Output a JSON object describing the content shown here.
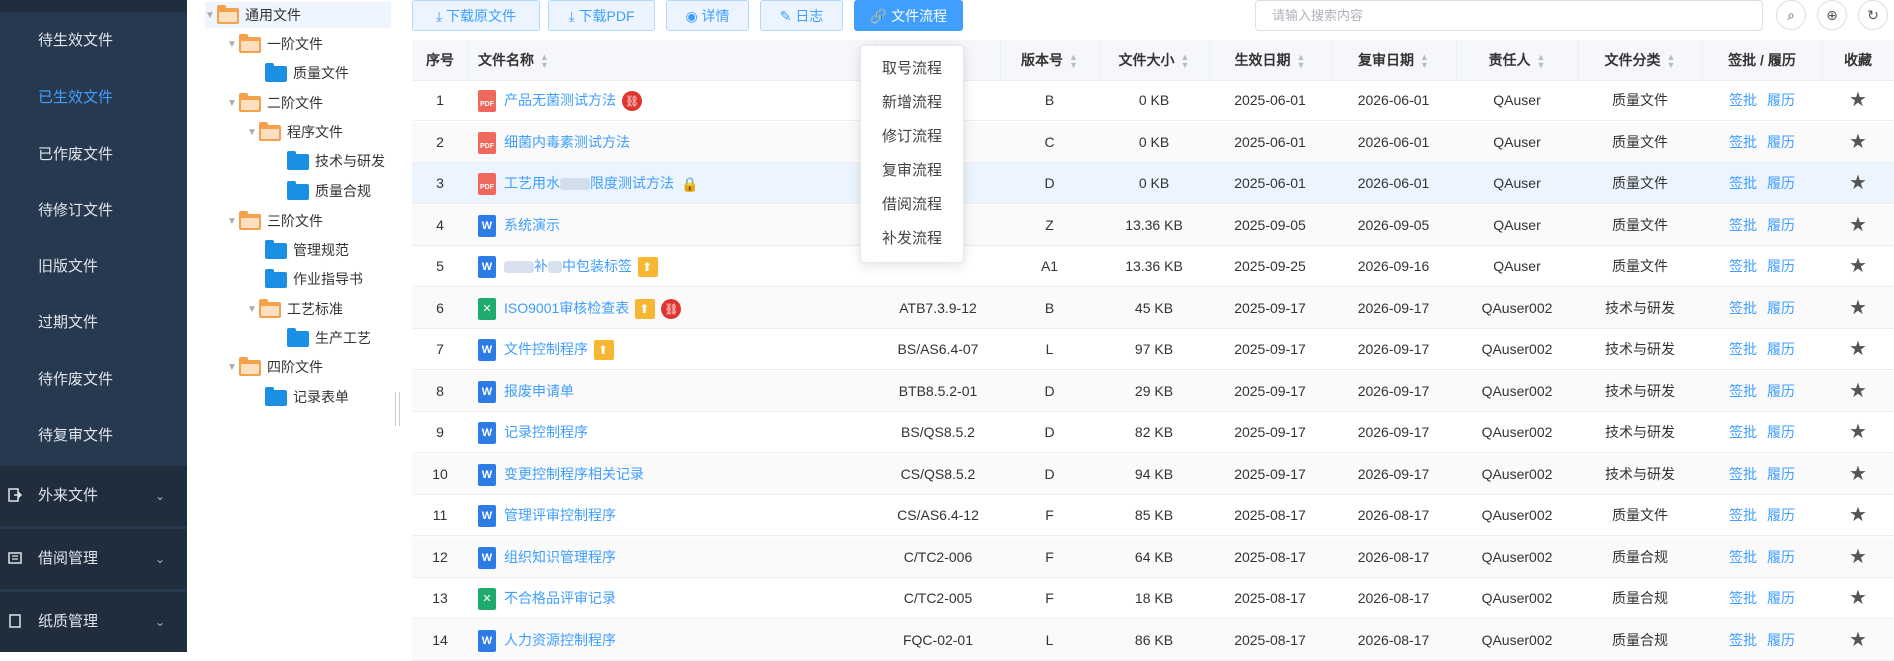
{
  "sidebar": {
    "items": [
      {
        "label": "待生效文件"
      },
      {
        "label": "已生效文件"
      },
      {
        "label": "已作废文件"
      },
      {
        "label": "待修订文件"
      },
      {
        "label": "旧版文件"
      },
      {
        "label": "过期文件"
      },
      {
        "label": "待作废文件"
      },
      {
        "label": "待复审文件"
      }
    ],
    "groups": [
      {
        "label": "外来文件"
      },
      {
        "label": "借阅管理"
      },
      {
        "label": "纸质管理"
      }
    ]
  },
  "tree": {
    "nodes": [
      {
        "label": "通用文件"
      },
      {
        "label": "一阶文件"
      },
      {
        "label": "质量文件"
      },
      {
        "label": "二阶文件"
      },
      {
        "label": "程序文件"
      },
      {
        "label": "技术与研发"
      },
      {
        "label": "质量合规"
      },
      {
        "label": "三阶文件"
      },
      {
        "label": "管理规范"
      },
      {
        "label": "作业指导书"
      },
      {
        "label": "工艺标准"
      },
      {
        "label": "生产工艺"
      },
      {
        "label": "四阶文件"
      },
      {
        "label": "记录表单"
      }
    ]
  },
  "toolbar": {
    "download_original": "下载原文件",
    "download_pdf": "下载PDF",
    "details": "详情",
    "log": "日志",
    "file_flow": "文件流程",
    "search_placeholder": "请输入搜索内容"
  },
  "dropdown": {
    "items": [
      "取号流程",
      "新增流程",
      "修订流程",
      "复审流程",
      "借阅流程",
      "补发流程"
    ]
  },
  "table": {
    "headers": {
      "index": "序号",
      "name": "文件名称",
      "version": "版本号",
      "size": "文件大小",
      "effective": "生效日期",
      "review": "复审日期",
      "owner": "责任人",
      "category": "文件分类",
      "actions": "签批 / 履历",
      "fav": "收藏"
    },
    "action_labels": {
      "sign": "签批",
      "history": "履历"
    },
    "rows": [
      {
        "idx": "1",
        "type": "pdf",
        "name": "产品无菌测试方法",
        "code": "",
        "ver": "B",
        "size": "0 KB",
        "eff": "2025-06-01",
        "rev": "2026-06-01",
        "owner": "QAuser",
        "cat": "质量文件"
      },
      {
        "idx": "2",
        "type": "pdf",
        "name": "细菌内毒素测试方法",
        "code": "",
        "ver": "C",
        "size": "0 KB",
        "eff": "2025-06-01",
        "rev": "2026-06-01",
        "owner": "QAuser",
        "cat": "质量文件"
      },
      {
        "idx": "3",
        "type": "pdf",
        "name": "工艺用水",
        "name_tail": "限度测试方法",
        "code": "",
        "ver": "D",
        "size": "0 KB",
        "eff": "2025-06-01",
        "rev": "2026-06-01",
        "owner": "QAuser",
        "cat": "质量文件"
      },
      {
        "idx": "4",
        "type": "w",
        "name": "系统演示",
        "code": "",
        "ver": "Z",
        "size": "13.36 KB",
        "eff": "2025-09-05",
        "rev": "2026-09-05",
        "owner": "QAuser",
        "cat": "质量文件"
      },
      {
        "idx": "5",
        "type": "w",
        "name": "补",
        "name_tail": "中包装标签",
        "code": "",
        "ver": "A1",
        "size": "13.36 KB",
        "eff": "2025-09-25",
        "rev": "2026-09-16",
        "owner": "QAuser",
        "cat": "质量文件"
      },
      {
        "idx": "6",
        "type": "x",
        "name": "ISO9001审核检查表",
        "code": "ATB7.3.9-12",
        "ver": "B",
        "size": "45 KB",
        "eff": "2025-09-17",
        "rev": "2026-09-17",
        "owner": "QAuser002",
        "cat": "技术与研发"
      },
      {
        "idx": "7",
        "type": "w",
        "name": "文件控制程序",
        "code": "BS/AS6.4-07",
        "ver": "L",
        "size": "97 KB",
        "eff": "2025-09-17",
        "rev": "2026-09-17",
        "owner": "QAuser002",
        "cat": "技术与研发"
      },
      {
        "idx": "8",
        "type": "w",
        "name": "报废申请单",
        "code": "BTB8.5.2-01",
        "ver": "D",
        "size": "29 KB",
        "eff": "2025-09-17",
        "rev": "2026-09-17",
        "owner": "QAuser002",
        "cat": "技术与研发"
      },
      {
        "idx": "9",
        "type": "w",
        "name": "记录控制程序",
        "code": "BS/QS8.5.2",
        "ver": "D",
        "size": "82 KB",
        "eff": "2025-09-17",
        "rev": "2026-09-17",
        "owner": "QAuser002",
        "cat": "技术与研发"
      },
      {
        "idx": "10",
        "type": "w",
        "name": "变更控制程序相关记录",
        "code": "CS/QS8.5.2",
        "ver": "D",
        "size": "94 KB",
        "eff": "2025-09-17",
        "rev": "2026-09-17",
        "owner": "QAuser002",
        "cat": "技术与研发"
      },
      {
        "idx": "11",
        "type": "w",
        "name": "管理评审控制程序",
        "code": "CS/AS6.4-12",
        "ver": "F",
        "size": "85 KB",
        "eff": "2025-08-17",
        "rev": "2026-08-17",
        "owner": "QAuser002",
        "cat": "质量文件"
      },
      {
        "idx": "12",
        "type": "w",
        "name": "组织知识管理程序",
        "code": "C/TC2-006",
        "ver": "F",
        "size": "64 KB",
        "eff": "2025-08-17",
        "rev": "2026-08-17",
        "owner": "QAuser002",
        "cat": "质量合规"
      },
      {
        "idx": "13",
        "type": "x",
        "name": "不合格品评审记录",
        "code": "C/TC2-005",
        "ver": "F",
        "size": "18 KB",
        "eff": "2025-08-17",
        "rev": "2026-08-17",
        "owner": "QAuser002",
        "cat": "质量合规"
      },
      {
        "idx": "14",
        "type": "w",
        "name": "人力资源控制程序",
        "code": "FQC-02-01",
        "ver": "L",
        "size": "86 KB",
        "eff": "2025-08-17",
        "rev": "2026-08-17",
        "owner": "QAuser002",
        "cat": "质量合规"
      }
    ]
  },
  "colors": {
    "accent": "#409eff",
    "sidebar_bg": "#27394f",
    "active_menu": "#409eff"
  }
}
